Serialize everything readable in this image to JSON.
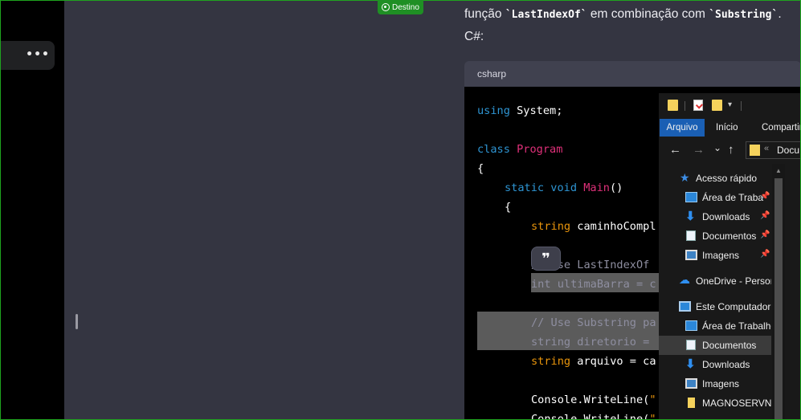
{
  "badge": {
    "label": "Destino"
  },
  "intro": {
    "line1_prefix": "função ",
    "code1": "`LastIndexOf`",
    "line1_mid": " em combinação com ",
    "code2": "`Substring`",
    "line1_end": ".",
    "line2": "C#:"
  },
  "sidebar": {
    "more_label": "•••"
  },
  "code": {
    "language": "csharp",
    "quote_icon": "❞",
    "lines": {
      "l1a": "using",
      "l1b": " System;",
      "l2a": "class",
      "l2b": " Program",
      "l3": "{",
      "l4a": "static",
      "l4b": " void",
      "l4c": " Main",
      "l4d": "()",
      "l5": "{",
      "l6a": "string",
      "l6b": " caminhoCompl",
      "l7": "// Use LastIndexOf",
      "l8": "int ultimaBarra = c",
      "l9": "// Use Substring pa",
      "l10": "string diretorio =",
      "l11a": "string",
      "l11b": " arquivo = ca",
      "l12a": "Console.WriteLine(",
      "l12b": "\"",
      "l13a": "Console.WriteLine(",
      "l13b": "\""
    }
  },
  "explorer": {
    "tabs": {
      "arquivo": "Arquivo",
      "inicio": "Início",
      "compartilhar": "Compartir"
    },
    "address": "Docu",
    "address_sep": "«",
    "nav": {
      "back": "←",
      "forward": "→",
      "recent": "⌄",
      "up": "↑"
    },
    "tree": {
      "acesso_rapido": "Acesso rápido",
      "area_trab_pin": "Área de Traba",
      "downloads_pin": "Downloads",
      "documentos_pin": "Documentos",
      "imagens_pin": "Imagens",
      "onedrive": "OneDrive - Persor",
      "este_computador": "Este Computador",
      "area_trabalho": "Área de Trabalho",
      "documentos": "Documentos",
      "downloads": "Downloads",
      "imagens": "Imagens",
      "magnoservna": "MAGNOSERVNA"
    },
    "pin": "📌"
  }
}
